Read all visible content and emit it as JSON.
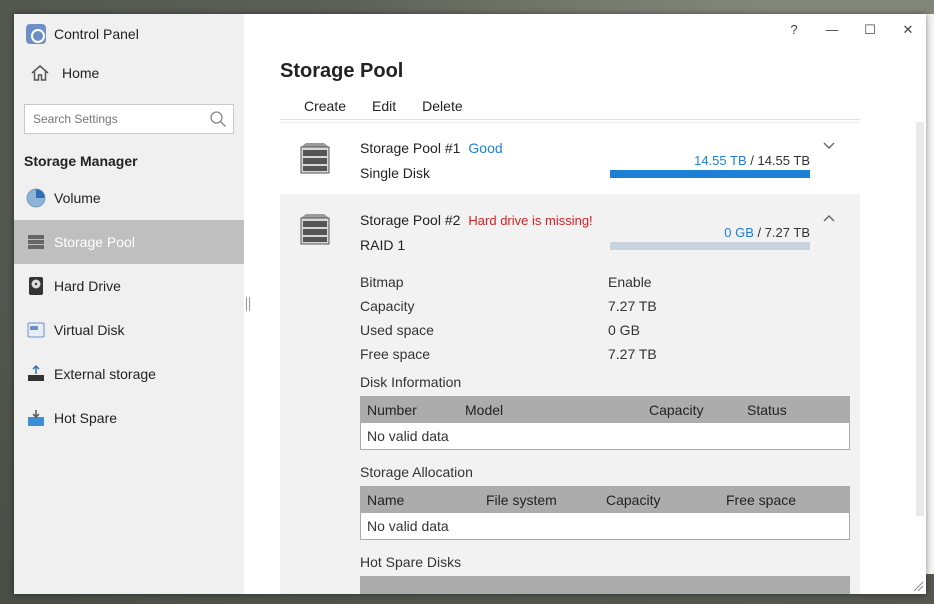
{
  "window": {
    "app_title": "Control Panel",
    "controls": {
      "help": "?",
      "minimize": "—",
      "maximize": "☐",
      "close": "✕"
    }
  },
  "sidebar": {
    "home_label": "Home",
    "search_placeholder": "Search Settings",
    "section_title": "Storage Manager",
    "items": [
      {
        "label": "Volume",
        "icon": "volume-icon",
        "active": false
      },
      {
        "label": "Storage Pool",
        "icon": "storage-pool-icon",
        "active": true
      },
      {
        "label": "Hard Drive",
        "icon": "hard-drive-icon",
        "active": false
      },
      {
        "label": "Virtual Disk",
        "icon": "virtual-disk-icon",
        "active": false
      },
      {
        "label": "External storage",
        "icon": "external-storage-icon",
        "active": false
      },
      {
        "label": "Hot Spare",
        "icon": "hot-spare-icon",
        "active": false
      }
    ]
  },
  "main": {
    "title": "Storage Pool",
    "toolbar": {
      "create": "Create",
      "edit": "Edit",
      "delete": "Delete"
    },
    "pools": [
      {
        "name": "Storage Pool #1",
        "status": "Good",
        "status_color": "#1e7fd6",
        "type": "Single Disk",
        "used": "14.55 TB",
        "separator": " / ",
        "total": "14.55 TB",
        "usage_fraction": 1.0,
        "expanded": false
      },
      {
        "name": "Storage Pool #2",
        "status": "Hard drive is missing!",
        "status_color": "#d32222",
        "type": "RAID 1",
        "used": "0 GB",
        "separator": " / ",
        "total": "7.27 TB",
        "usage_fraction": 0.0,
        "expanded": true,
        "details": [
          {
            "key": "Bitmap",
            "value": "Enable"
          },
          {
            "key": "Capacity",
            "value": "7.27 TB"
          },
          {
            "key": "Used space",
            "value": "0 GB"
          },
          {
            "key": "Free space",
            "value": "7.27 TB"
          }
        ],
        "disk_information": {
          "title": "Disk Information",
          "columns": [
            "Number",
            "Model",
            "Capacity",
            "Status"
          ],
          "empty_text": "No valid data"
        },
        "storage_allocation": {
          "title": "Storage Allocation",
          "columns": [
            "Name",
            "File system",
            "Capacity",
            "Free space"
          ],
          "empty_text": "No valid data"
        },
        "hot_spare_disks": {
          "title": "Hot Spare Disks"
        }
      }
    ]
  },
  "colors": {
    "accent": "#1e7fd6",
    "error": "#d32222",
    "sidebar_active": "#bfbfbf",
    "table_header": "#acacac"
  }
}
